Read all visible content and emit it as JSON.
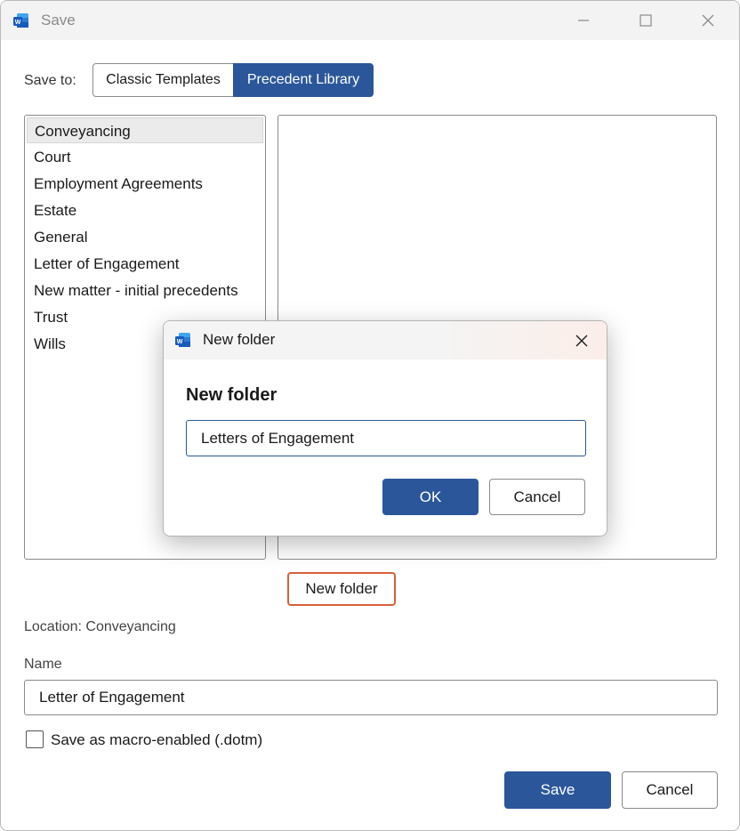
{
  "window": {
    "title": "Save",
    "icon": "word-app-icon",
    "controls": {
      "minimize": "minimize-icon",
      "maximize": "maximize-icon",
      "close": "close-icon"
    }
  },
  "save_to": {
    "label": "Save to:",
    "options": [
      "Classic Templates",
      "Precedent Library"
    ],
    "selected": "Precedent Library"
  },
  "folders": {
    "items": [
      "Conveyancing",
      "Court",
      "Employment Agreements",
      "Estate",
      "General",
      "Letter of Engagement",
      "New matter - initial precedents",
      "Trust",
      "Wills"
    ],
    "selected_index": 0
  },
  "new_folder_button": "New folder",
  "location": "Location: Conveyancing",
  "name": {
    "label": "Name",
    "value": "Letter of Engagement"
  },
  "macro_checkbox": {
    "label": "Save as macro-enabled (.dotm)",
    "checked": false
  },
  "buttons": {
    "save": "Save",
    "cancel": "Cancel"
  },
  "modal": {
    "title": "New folder",
    "heading": "New folder",
    "input_value": "Letters of Engagement",
    "ok": "OK",
    "cancel": "Cancel"
  },
  "colors": {
    "accent": "#2b579a",
    "focus_outline": "#d9603b"
  }
}
